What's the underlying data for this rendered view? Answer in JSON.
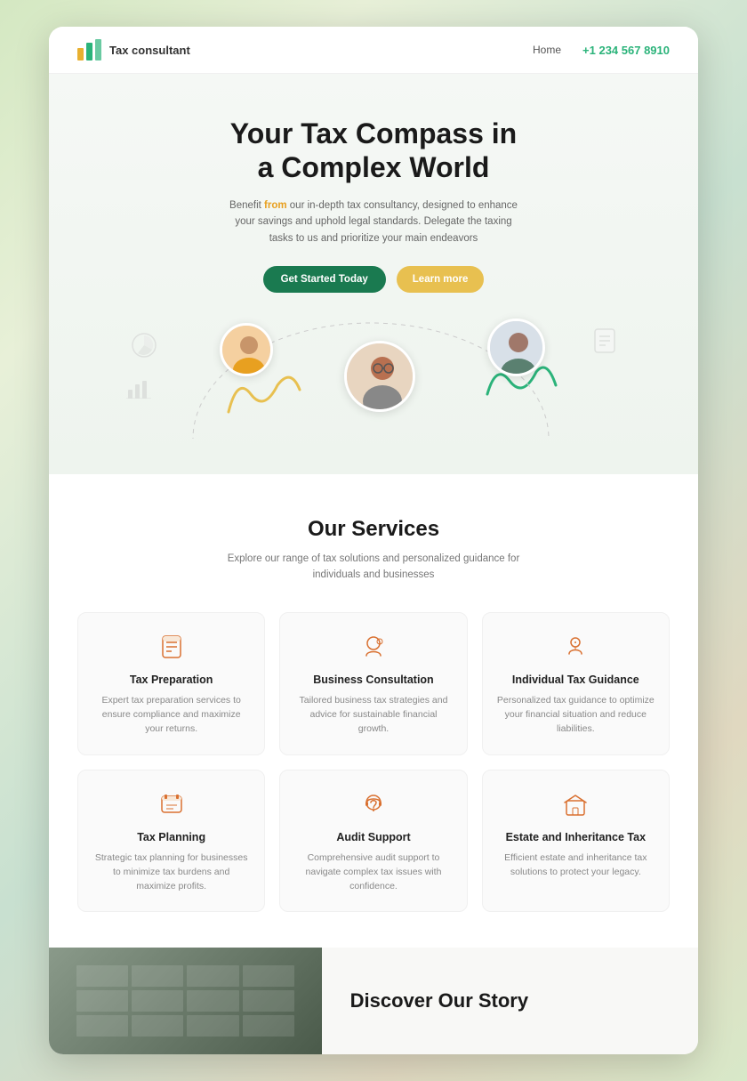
{
  "nav": {
    "logo_text": "Tax consultant",
    "home_label": "Home",
    "phone": "+1 234 567 8910"
  },
  "hero": {
    "heading_line1": "Your Tax Compass in",
    "heading_line2": "a Complex World",
    "subtitle_pre": "Benefit ",
    "subtitle_highlight": "from",
    "subtitle_post": " our in-depth tax consultancy, designed to enhance your savings and uphold legal standards. Delegate the taxing tasks to us and prioritize your main endeavors",
    "btn_primary": "Get Started Today",
    "btn_secondary": "Learn more"
  },
  "services": {
    "heading": "Our Services",
    "subtitle": "Explore our range of tax solutions and personalized guidance for individuals and businesses",
    "cards": [
      {
        "icon": "📋",
        "title": "Tax Preparation",
        "desc": "Expert tax preparation services to ensure compliance and maximize your returns."
      },
      {
        "icon": "💼",
        "title": "Business Consultation",
        "desc": "Tailored business tax strategies and advice for sustainable financial growth."
      },
      {
        "icon": "👤",
        "title": "Individual Tax Guidance",
        "desc": "Personalized tax guidance to optimize your financial situation and reduce liabilities."
      },
      {
        "icon": "📚",
        "title": "Tax Planning",
        "desc": "Strategic tax planning for businesses to minimize tax burdens and maximize profits."
      },
      {
        "icon": "🎧",
        "title": "Audit Support",
        "desc": "Comprehensive audit support to navigate complex tax issues with confidence."
      },
      {
        "icon": "📄",
        "title": "Estate and Inheritance Tax",
        "desc": "Efficient estate and inheritance tax solutions to protect your legacy."
      }
    ]
  },
  "discover": {
    "heading": "Discover Our Story"
  },
  "colors": {
    "accent_green": "#1a7a50",
    "accent_yellow": "#e8c050",
    "accent_orange": "#d97030",
    "logo_green": "#2bb37a"
  }
}
